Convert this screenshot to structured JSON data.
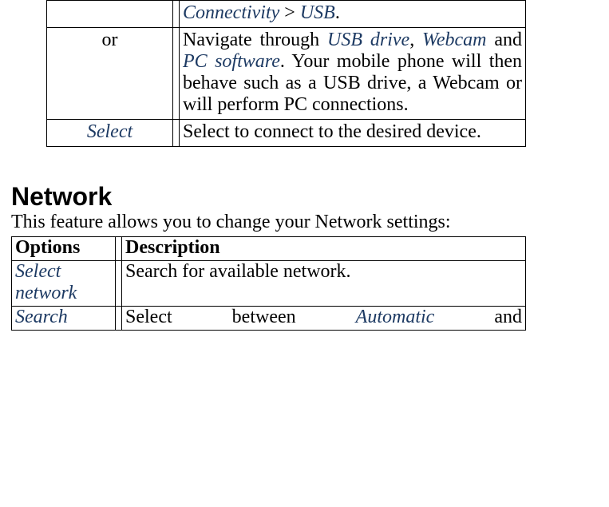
{
  "table1": {
    "rows": [
      {
        "left": "",
        "right_emph_a": "Connectivity",
        "right_gt": " > ",
        "right_emph_b": "USB",
        "right_period": "."
      },
      {
        "left": "or",
        "r_pre": "Navigate through ",
        "r_usb": "USB drive",
        "r_comma": ", ",
        "r_webcam": "Webcam",
        "r_and": " and ",
        "r_pcsw": "PC software",
        "r_post": ". Your mobile phone will then behave such as a USB drive, a Webcam or will perform PC connections."
      },
      {
        "left": "Select",
        "right": "Select to connect to the desired device."
      }
    ]
  },
  "section": {
    "heading": "Network",
    "intro": "This feature allows you to change your Network settings:"
  },
  "table2": {
    "headers": {
      "c1": "Options",
      "c2": "Description"
    },
    "rows": [
      {
        "left": "Select network",
        "right": "Search for available network."
      },
      {
        "left": "Search",
        "r_pre": "Select between ",
        "r_auto": "Automatic",
        "r_post": " and"
      }
    ]
  }
}
